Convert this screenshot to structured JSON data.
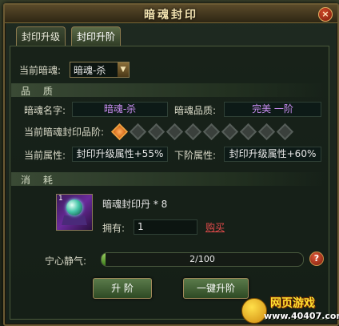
{
  "window": {
    "title": "暗魂封印"
  },
  "tabs": [
    {
      "label": "封印升级"
    },
    {
      "label": "封印升阶"
    }
  ],
  "current_soul": {
    "label": "当前暗魂:",
    "value": "暗魂-杀"
  },
  "quality_section": {
    "title": "品 质"
  },
  "soul_name": {
    "label": "暗魂名字:",
    "value": "暗魂-杀"
  },
  "soul_quality": {
    "label": "暗魂品质:",
    "value": "完美 一阶"
  },
  "seal_level": {
    "label": "当前暗魂封印品阶:",
    "filled": 1,
    "total": 10
  },
  "current_attr": {
    "label": "当前属性:",
    "value": "封印升级属性+55%"
  },
  "next_attr": {
    "label": "下阶属性:",
    "value": "封印升级属性+60%"
  },
  "consume_section": {
    "title": "消 耗"
  },
  "item": {
    "name": "暗魂封印丹 * 8",
    "corner_count": "1",
    "icon": "soul-orb-icon"
  },
  "owned": {
    "label": "拥有:",
    "value": "1"
  },
  "buy": {
    "label": "购买"
  },
  "calm": {
    "label": "宁心静气:",
    "current": 2,
    "max": 100,
    "text": "2/100"
  },
  "buttons": {
    "upgrade": "升 阶",
    "one_click": "一键升阶"
  },
  "logo": {
    "line1": "网页游戏",
    "line2": "www.40407.com"
  },
  "colors": {
    "purple": "#c88cf0",
    "buy_red": "#e04a4a",
    "active_gem": "#f0a040"
  }
}
